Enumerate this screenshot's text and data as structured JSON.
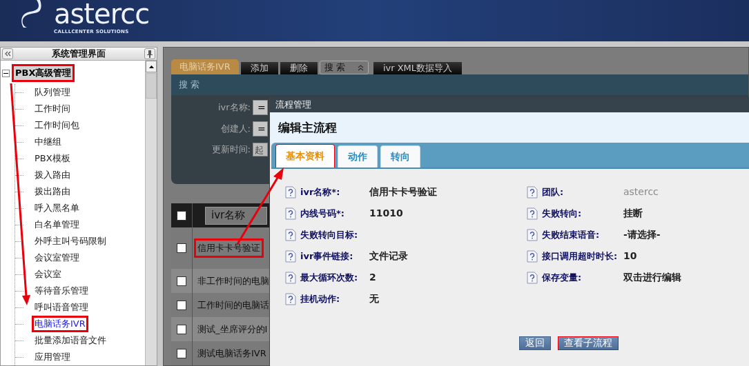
{
  "header": {
    "logo": "astercc",
    "tagline": "CALLLCENTER SOLUTIONS"
  },
  "sidebar": {
    "title": "系统管理界面",
    "tree": [
      {
        "label": "PBX高级管理",
        "expanded": true,
        "highlighted": true,
        "children": [
          {
            "label": "队列管理",
            "selected": false,
            "highlighted": false
          },
          {
            "label": "工作时间",
            "selected": false,
            "highlighted": false
          },
          {
            "label": "工作时间包",
            "selected": false,
            "highlighted": false
          },
          {
            "label": "中继组",
            "selected": false,
            "highlighted": false
          },
          {
            "label": "PBX模板",
            "selected": false,
            "highlighted": false
          },
          {
            "label": "拨入路由",
            "selected": false,
            "highlighted": false
          },
          {
            "label": "拨出路由",
            "selected": false,
            "highlighted": false
          },
          {
            "label": "呼入黑名单",
            "selected": false,
            "highlighted": false
          },
          {
            "label": "白名单管理",
            "selected": false,
            "highlighted": false
          },
          {
            "label": "外呼主叫号码限制",
            "selected": false,
            "highlighted": false
          },
          {
            "label": "会议室管理",
            "selected": false,
            "highlighted": false
          },
          {
            "label": "会议室",
            "selected": false,
            "highlighted": false
          },
          {
            "label": "等待音乐管理",
            "selected": false,
            "highlighted": false
          },
          {
            "label": "呼叫语音管理",
            "selected": false,
            "highlighted": false
          },
          {
            "label": "电脑话务IVR",
            "selected": true,
            "highlighted": true
          },
          {
            "label": "批量添加语音文件",
            "selected": false,
            "highlighted": false
          },
          {
            "label": "应用管理",
            "selected": false,
            "highlighted": false
          }
        ]
      }
    ]
  },
  "toolbar": [
    {
      "kind": "tab",
      "label": "电脑话务IVR",
      "selected": true
    },
    {
      "kind": "button",
      "label": "添加"
    },
    {
      "kind": "button",
      "label": "删除"
    },
    {
      "kind": "select",
      "label": "搜 索"
    },
    {
      "kind": "button",
      "label": "ivr XML数据导入"
    }
  ],
  "search_panel": {
    "title": "搜 索",
    "fields": [
      {
        "kind": "operator",
        "label": "ivr名称:",
        "value": "="
      },
      {
        "kind": "operator",
        "label": "创建人:",
        "value": "="
      },
      {
        "kind": "date",
        "label": "更新时间:",
        "placeholder": "起"
      }
    ]
  },
  "table": {
    "columns": [
      "ivr名称"
    ],
    "all_checked": false,
    "rows": [
      {
        "name": "信用卡卡号验证",
        "checked": false,
        "highlighted": true
      },
      {
        "name": "非工作时间的电脑",
        "checked": false,
        "highlighted": false
      },
      {
        "name": "工作时间的电脑话",
        "checked": false,
        "highlighted": false
      },
      {
        "name": "测试_坐席评分的I",
        "checked": false,
        "highlighted": false
      },
      {
        "name": "测试电脑话务IVR",
        "checked": false,
        "highlighted": false
      }
    ]
  },
  "dialog": {
    "title": "流程管理",
    "heading": "编辑主流程",
    "tabs": [
      {
        "label": "基本资料",
        "selected": true,
        "highlighted": true
      },
      {
        "label": "动作",
        "selected": false,
        "highlighted": false
      },
      {
        "label": "转向",
        "selected": false,
        "highlighted": false
      }
    ],
    "fields_left": [
      {
        "label": "ivr名称*:",
        "value": "信用卡卡号验证"
      },
      {
        "label": "内线号码*:",
        "value": "11010"
      },
      {
        "label": "失败转向目标:"
      },
      {
        "label": "ivr事件链接:",
        "value": "文件记录"
      },
      {
        "label": "最大循环次数:",
        "value": "2"
      },
      {
        "label": "挂机动作:",
        "value": "无"
      }
    ],
    "fields_right": [
      {
        "label": "团队:",
        "value": "astercc",
        "disabled": true
      },
      {
        "label": "失败转向:",
        "value": "挂断",
        "disabled": false
      },
      {
        "label": "失败结束语音:",
        "value": "-请选择-",
        "disabled": false
      },
      {
        "label": "接口调用超时时长:",
        "value": "10",
        "disabled": false
      },
      {
        "label": "保存变量:",
        "value": "双击进行编辑",
        "disabled": false
      }
    ],
    "buttons": [
      {
        "label": "返回",
        "highlighted": false
      },
      {
        "label": "查看子流程",
        "highlighted": true
      }
    ]
  }
}
